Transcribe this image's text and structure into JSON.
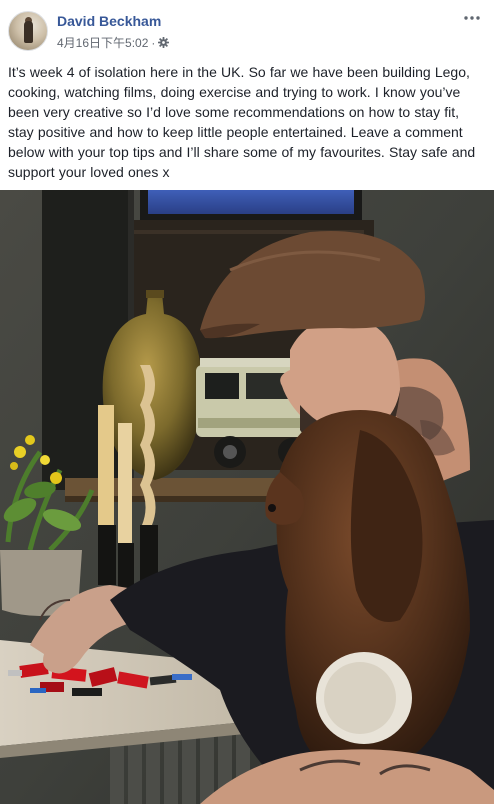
{
  "post": {
    "author": "David Beckham",
    "timestamp": "4月16日下午5:02",
    "separator": "·",
    "audience_icon": "gear-icon",
    "more_icon": "more-horizontal-icon",
    "text": "It’s week 4 of isolation here in the UK. So far we have been building Lego, cooking, watching films, doing exercise and trying to work. I know you’ve been very creative so I’d love some recommendations on how to stay fit, stay positive and how to keep little people entertained. Leave a comment below with your top tips and I’ll share some of my favourites. Stay safe and support your loved ones x"
  },
  "colors": {
    "author_link": "#385898",
    "meta_text": "#616770",
    "body_text": "#1d2129"
  }
}
